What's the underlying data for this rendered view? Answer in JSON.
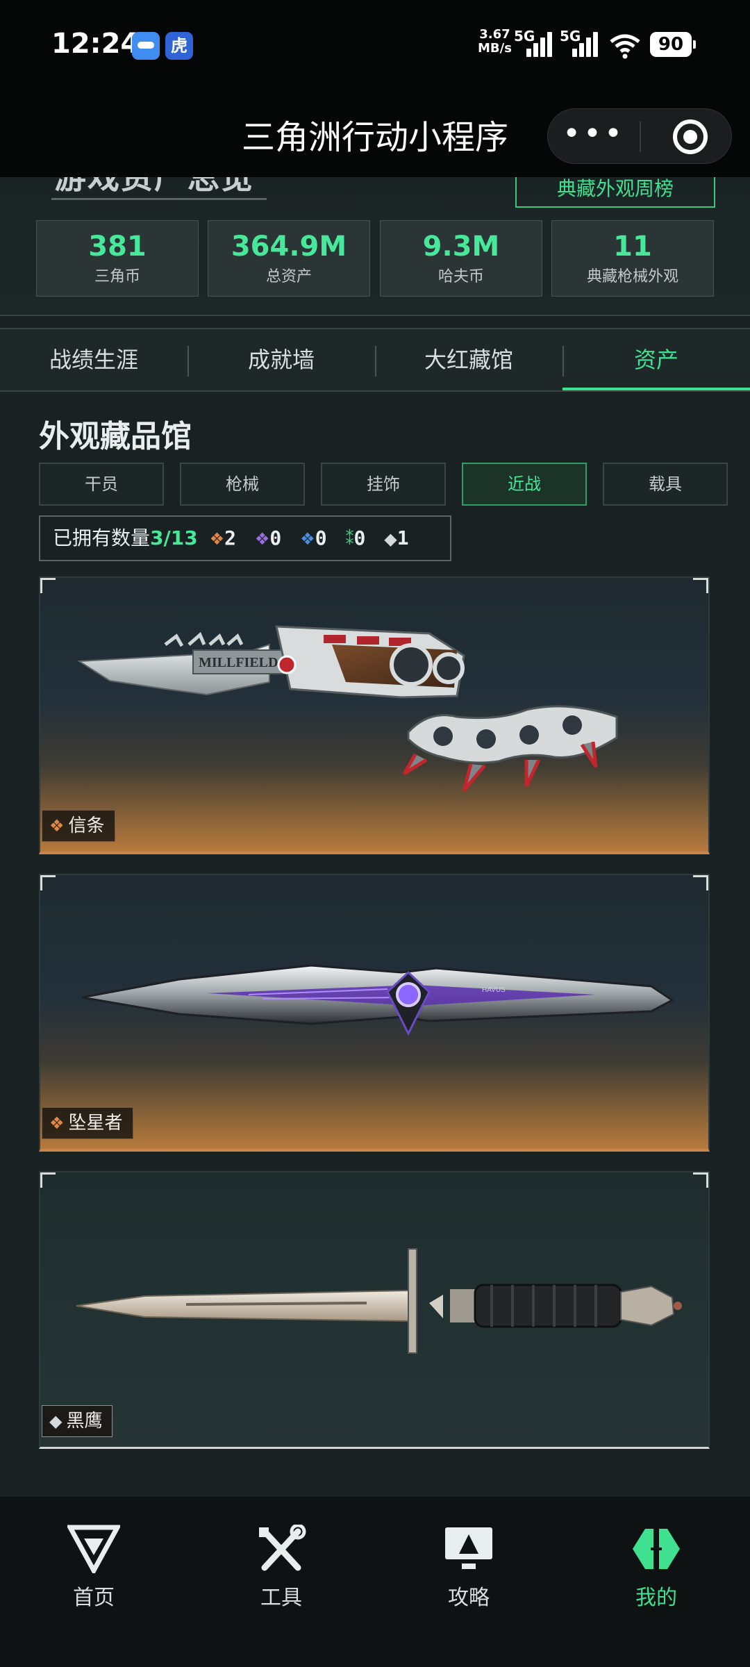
{
  "status_bar": {
    "time": "12:24",
    "app2_glyph": "虎",
    "net_speed_value": "3.67",
    "net_speed_unit": "MB/s",
    "sim1": "5G",
    "sim2": "5G",
    "battery": "90"
  },
  "title_bar": {
    "title": "三角洲行动小程序",
    "more_glyph": "•••"
  },
  "overview": {
    "title": "游戏资产总览",
    "weekly_button": "典藏外观周榜",
    "stats": [
      {
        "value": "381",
        "label": "三角币"
      },
      {
        "value": "364.9M",
        "label": "总资产"
      },
      {
        "value": "9.3M",
        "label": "哈夫币"
      },
      {
        "value": "11",
        "label": "典藏枪械外观"
      }
    ]
  },
  "tabs": [
    {
      "label": "战绩生涯"
    },
    {
      "label": "成就墙"
    },
    {
      "label": "大红藏馆"
    },
    {
      "label": "资产",
      "active": true
    }
  ],
  "collection": {
    "title": "外观藏品馆",
    "filters": [
      {
        "label": "干员"
      },
      {
        "label": "枪械"
      },
      {
        "label": "挂饰"
      },
      {
        "label": "近战",
        "active": true
      },
      {
        "label": "载具"
      }
    ],
    "owned_label": "已拥有数量",
    "owned_count": "3/13",
    "rarity_counts": [
      {
        "color": "#e0874a",
        "count": "2"
      },
      {
        "color": "#9b6ee0",
        "count": "0"
      },
      {
        "color": "#4c8fe0",
        "count": "0"
      },
      {
        "color": "#3fcf7f",
        "count": "0"
      },
      {
        "color": "#d5d9d9",
        "count": "1"
      }
    ],
    "items": [
      {
        "name": "信条",
        "rarity_color": "#e0874a",
        "engraving": "MILLFIELD"
      },
      {
        "name": "坠星者",
        "rarity_color": "#e0874a",
        "engraving": "HAVUS"
      },
      {
        "name": "黑鹰",
        "rarity_color": "#d5d9d9",
        "engraving": ""
      }
    ]
  },
  "bottom_nav": [
    {
      "label": "首页",
      "icon": "home-icon"
    },
    {
      "label": "工具",
      "icon": "tools-icon"
    },
    {
      "label": "攻略",
      "icon": "guide-icon"
    },
    {
      "label": "我的",
      "icon": "profile-icon",
      "active": true
    }
  ],
  "colors": {
    "accent": "#3fe08f",
    "gold_rarity": "#e0874a",
    "background": "#1a2122"
  }
}
